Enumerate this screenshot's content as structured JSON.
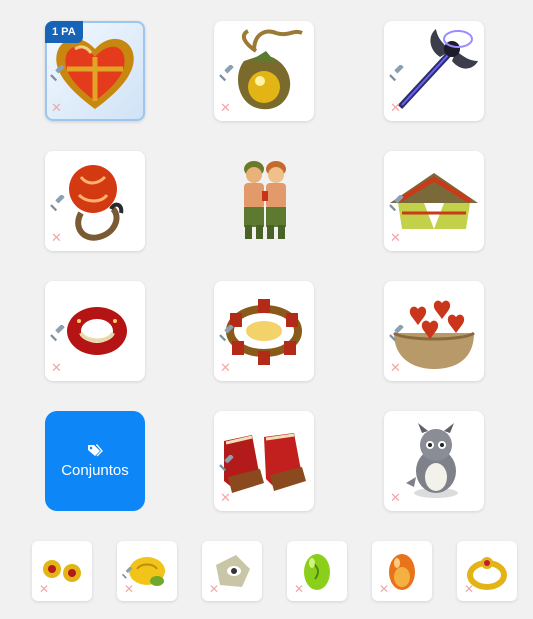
{
  "badge": {
    "label": "1 PA"
  },
  "sets_button": {
    "label": "Conjuntos",
    "icon": "tags-icon"
  },
  "slots": {
    "amulet": {
      "icon": "heart-amulet-icon",
      "selected": true
    },
    "hat_pendant": {
      "icon": "fig-pendant-icon"
    },
    "weapon": {
      "icon": "bat-wing-staff-icon"
    },
    "ring_left": {
      "icon": "red-orb-ring-icon"
    },
    "character": {
      "icon": "character-preview-icon"
    },
    "cape": {
      "icon": "straw-tent-cape-icon"
    },
    "ring_right": {
      "icon": "red-ring-icon"
    },
    "belt": {
      "icon": "lantern-belt-icon"
    },
    "shield": {
      "icon": "heart-bag-icon"
    },
    "boots": {
      "icon": "red-boots-icon"
    },
    "pet": {
      "icon": "grey-dragon-pet-icon"
    }
  },
  "dofus": [
    {
      "icon": "cherry-earrings-icon"
    },
    {
      "icon": "golden-turtle-dofus-icon"
    },
    {
      "icon": "stone-eye-dofus-icon"
    },
    {
      "icon": "green-dofus-icon"
    },
    {
      "icon": "amber-dofus-icon"
    },
    {
      "icon": "gold-ruby-ring-icon"
    }
  ],
  "actions": {
    "hammer_icon": "hammer-icon",
    "remove_icon": "remove-x-icon",
    "remove_symbol": "✕"
  }
}
